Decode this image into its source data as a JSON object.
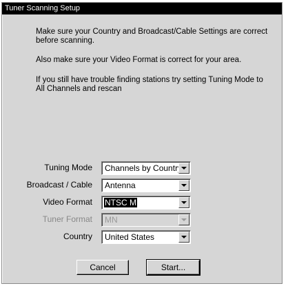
{
  "window": {
    "title": "Tuner Scanning Setup"
  },
  "messages": [
    "Make sure your Country and Broadcast/Cable Settings are correct before scanning.",
    "Also make sure your Video Format is correct for your area.",
    "If you still have trouble finding stations try setting Tuning Mode to All Channels and rescan"
  ],
  "fields": {
    "tuning_mode": {
      "label": "Tuning Mode",
      "value": "Channels by Country"
    },
    "broadcast_cable": {
      "label": "Broadcast / Cable",
      "value": "Antenna"
    },
    "video_format": {
      "label": "Video Format",
      "value": "NTSC M"
    },
    "tuner_format": {
      "label": "Tuner Format",
      "value": "MN",
      "disabled": true
    },
    "country": {
      "label": "Country",
      "value": "United States"
    }
  },
  "buttons": {
    "cancel": "Cancel",
    "start": "Start..."
  }
}
